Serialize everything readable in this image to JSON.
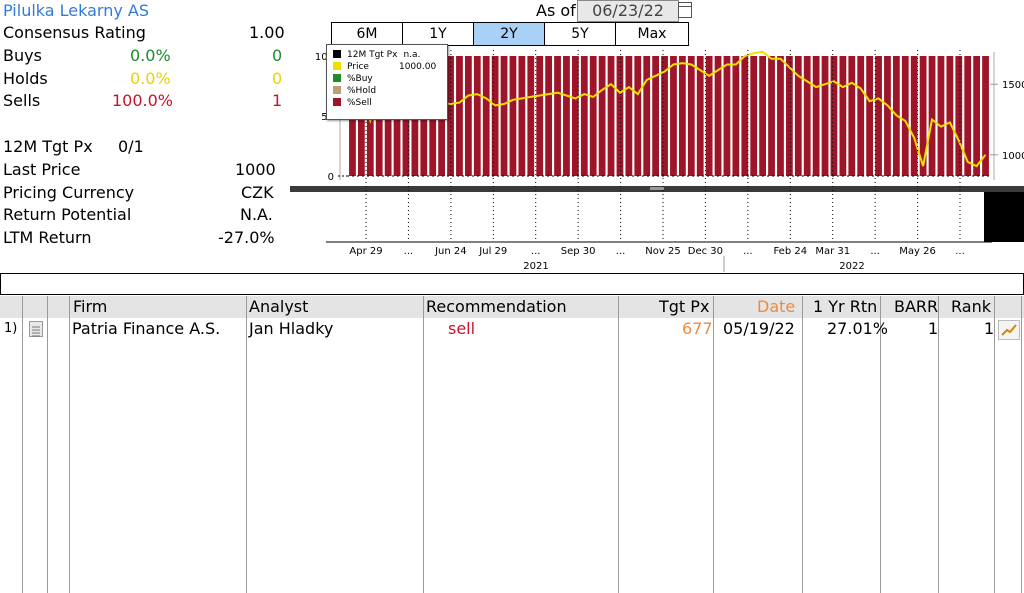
{
  "security": {
    "name": "Pilulka Lekarny AS",
    "as_of_label": "As of",
    "as_of_date": "06/23/22"
  },
  "summary": {
    "consensus_label": "Consensus Rating",
    "consensus_value": "1.00",
    "buys_label": "Buys",
    "buys_pct": "0.0%",
    "buys_count": "0",
    "holds_label": "Holds",
    "holds_pct": "0.0%",
    "holds_count": "0",
    "sells_label": "Sells",
    "sells_pct": "100.0%",
    "sells_count": "1",
    "tgt_label": "12M Tgt Px",
    "tgt_value": "0/1",
    "last_price_label": "Last Price",
    "last_price_value": "1000",
    "currency_label": "Pricing Currency",
    "currency_value": "CZK",
    "return_potential_label": "Return Potential",
    "return_potential_value": "N.A.",
    "ltm_label": "LTM Return",
    "ltm_value": "-27.0%"
  },
  "periods": [
    {
      "label": "6M",
      "active": false
    },
    {
      "label": "1Y",
      "active": false
    },
    {
      "label": "2Y",
      "active": true
    },
    {
      "label": "5Y",
      "active": false
    },
    {
      "label": "Max",
      "active": false
    }
  ],
  "legend": {
    "items": [
      {
        "label": "12M Tgt Px",
        "value": "n.a.",
        "color": "#000000"
      },
      {
        "label": "Price",
        "value": "1000.00",
        "color": "#f0e000"
      },
      {
        "label": "%Buy",
        "value": "",
        "color": "#1f8a2a"
      },
      {
        "label": "%Hold",
        "value": "",
        "color": "#b8a070"
      },
      {
        "label": "%Sell",
        "value": "",
        "color": "#9e1428"
      }
    ]
  },
  "chart_data": {
    "type": "bar",
    "left_axis": {
      "ticks": [
        "100",
        "50",
        "0"
      ],
      "range": [
        0,
        100
      ]
    },
    "right_axis": {
      "ticks": [
        "1500",
        "1000"
      ],
      "range": [
        850,
        1700
      ]
    },
    "x_ticks": [
      "Apr 29",
      "...",
      "Jun 24",
      "Jul 29",
      "...",
      "Sep 30",
      "...",
      "Nov 25",
      "Dec 30",
      "...",
      "Feb 24",
      "Mar 31",
      "...",
      "May 26",
      "..."
    ],
    "years": [
      "2021",
      "2022"
    ],
    "series": [
      {
        "name": "%Sell",
        "color": "#9e1428",
        "values": [
          100,
          100,
          100,
          100,
          100,
          100,
          100,
          100,
          100,
          100,
          100,
          100,
          100,
          100,
          100,
          100,
          100,
          100,
          100,
          100,
          100,
          100,
          100,
          100,
          100,
          100,
          100,
          100,
          100,
          100,
          100,
          100,
          100,
          100,
          100,
          100,
          100,
          100,
          100,
          100,
          100,
          100,
          100,
          100,
          100,
          100,
          100,
          100,
          100,
          100,
          100,
          100,
          100,
          100,
          100,
          100,
          100,
          100,
          100,
          100,
          100,
          100,
          100,
          100,
          100,
          100,
          100,
          100,
          100,
          100,
          100,
          100
        ]
      },
      {
        "name": "Price",
        "color": "#f0e000",
        "values": [
          1320,
          1380,
          1240,
          1420,
          1400,
          1350,
          1420,
          1330,
          1380,
          1340,
          1370,
          1360,
          1370,
          1420,
          1430,
          1400,
          1350,
          1360,
          1390,
          1400,
          1410,
          1420,
          1430,
          1440,
          1420,
          1400,
          1430,
          1410,
          1460,
          1500,
          1440,
          1480,
          1430,
          1530,
          1560,
          1590,
          1640,
          1650,
          1640,
          1600,
          1560,
          1600,
          1640,
          1640,
          1700,
          1720,
          1730,
          1680,
          1680,
          1620,
          1560,
          1520,
          1480,
          1500,
          1520,
          1480,
          1510,
          1470,
          1380,
          1400,
          1350,
          1280,
          1240,
          1120,
          920,
          1250,
          1200,
          1230,
          1100,
          950,
          920,
          1000
        ]
      }
    ]
  },
  "table": {
    "columns": [
      "Firm",
      "Analyst",
      "Recommendation",
      "Tgt Px",
      "Date",
      "1 Yr Rtn",
      "BARR",
      "Rank"
    ],
    "rows": [
      {
        "num": "1)",
        "firm": "Patria Finance A.S.",
        "analyst": "Jan Hladky",
        "recommendation": "sell",
        "tgt_px": "677",
        "date": "05/19/22",
        "rtn": "27.01%",
        "barr": "1",
        "rank": "1"
      }
    ]
  },
  "colors": {
    "accent_blue": "#2f7bd6",
    "sell_red": "#9e1428",
    "price_yellow": "#f0e000",
    "active_tab": "#a9d0f5"
  }
}
